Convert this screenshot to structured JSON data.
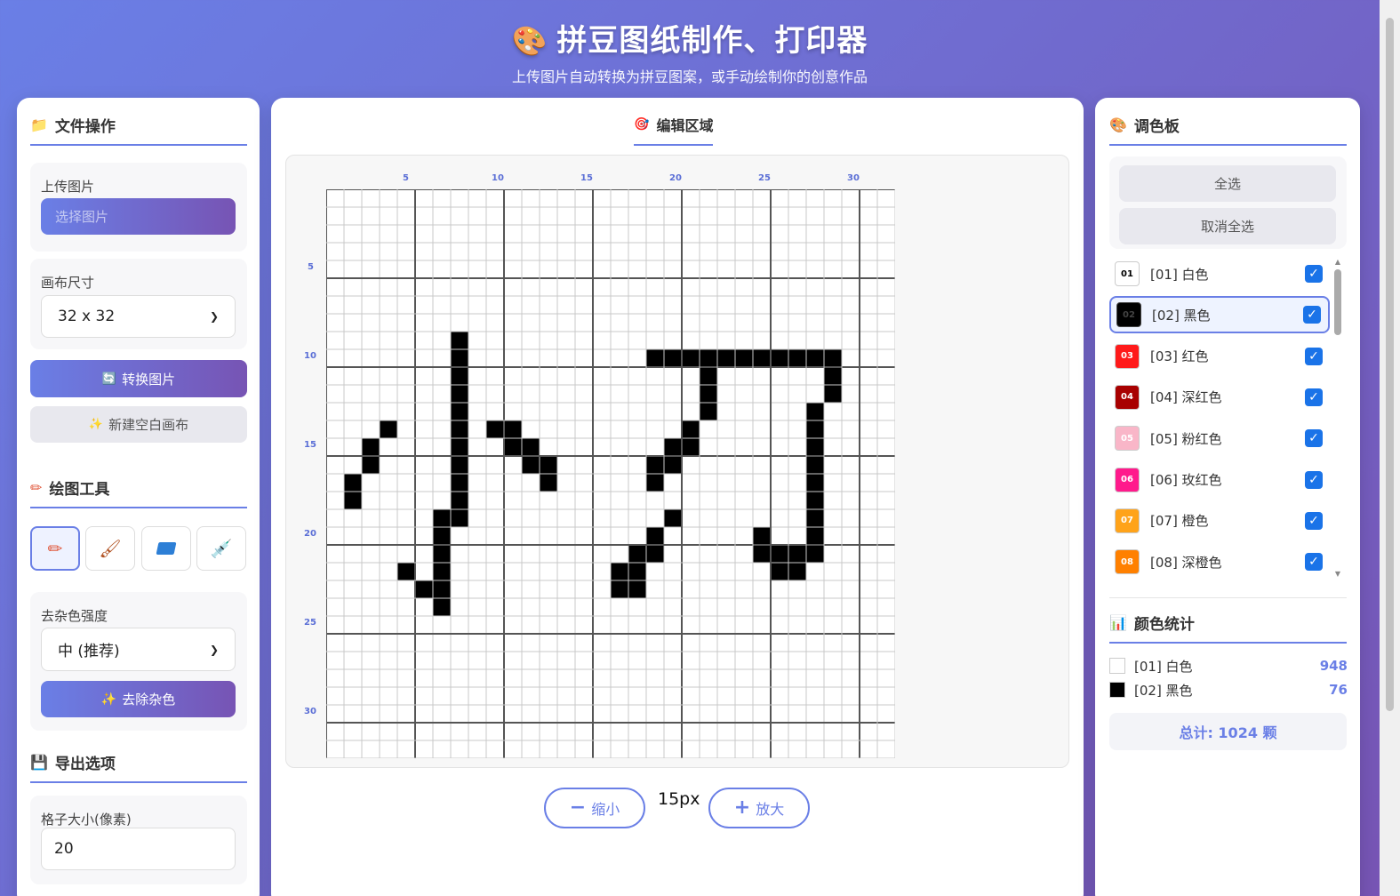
{
  "header": {
    "icon": "palette-icon",
    "title": "拼豆图纸制作、打印器",
    "subtitle": "上传图片自动转换为拼豆图案，或手动绘制你的创意作品"
  },
  "left": {
    "file_ops": {
      "title": "文件操作",
      "icon": "folder-icon"
    },
    "upload_label": "上传图片",
    "upload_button": "选择图片",
    "canvas_size_label": "画布尺寸",
    "canvas_size_value": "32 x 32",
    "convert_button": "转换图片",
    "new_canvas_button": "新建空白画布",
    "drawing_tools": {
      "title": "绘图工具",
      "icon": "pencil-icon"
    },
    "tools": [
      {
        "name": "pencil",
        "icon": "pencil-icon",
        "active": true
      },
      {
        "name": "brush",
        "icon": "paintbrush-icon",
        "active": false
      },
      {
        "name": "eraser",
        "icon": "eraser-icon",
        "active": false
      },
      {
        "name": "eyedropper",
        "icon": "eyedropper-icon",
        "active": false
      }
    ],
    "denoise_label": "去杂色强度",
    "denoise_value": "中 (推荐)",
    "denoise_button": "去除杂色",
    "export": {
      "title": "导出选项",
      "icon": "floppy-icon"
    },
    "cell_size_label": "格子大小(像素)",
    "cell_size_value": "20"
  },
  "center": {
    "title": "编辑区域",
    "icon": "target-icon",
    "grid_cols": 32,
    "grid_rows": 32,
    "axis_labels": [
      "5",
      "10",
      "15",
      "20",
      "25",
      "30"
    ],
    "black_cells": [
      [
        8,
        9
      ],
      [
        8,
        10
      ],
      [
        8,
        11
      ],
      [
        8,
        12
      ],
      [
        8,
        13
      ],
      [
        8,
        14
      ],
      [
        8,
        15
      ],
      [
        8,
        16
      ],
      [
        8,
        17
      ],
      [
        8,
        18
      ],
      [
        8,
        19
      ],
      [
        7,
        19
      ],
      [
        7,
        20
      ],
      [
        7,
        21
      ],
      [
        7,
        22
      ],
      [
        7,
        23
      ],
      [
        7,
        24
      ],
      [
        6,
        23
      ],
      [
        5,
        22
      ],
      [
        4,
        14
      ],
      [
        3,
        15
      ],
      [
        3,
        16
      ],
      [
        2,
        17
      ],
      [
        2,
        18
      ],
      [
        10,
        14
      ],
      [
        11,
        14
      ],
      [
        11,
        15
      ],
      [
        12,
        15
      ],
      [
        12,
        16
      ],
      [
        13,
        16
      ],
      [
        13,
        17
      ],
      [
        19,
        10
      ],
      [
        20,
        10
      ],
      [
        21,
        10
      ],
      [
        22,
        10
      ],
      [
        23,
        10
      ],
      [
        24,
        10
      ],
      [
        25,
        10
      ],
      [
        26,
        10
      ],
      [
        27,
        10
      ],
      [
        28,
        10
      ],
      [
        29,
        10
      ],
      [
        22,
        11
      ],
      [
        22,
        12
      ],
      [
        22,
        13
      ],
      [
        29,
        11
      ],
      [
        29,
        12
      ],
      [
        21,
        14
      ],
      [
        21,
        15
      ],
      [
        20,
        15
      ],
      [
        20,
        16
      ],
      [
        19,
        16
      ],
      [
        19,
        17
      ],
      [
        20,
        19
      ],
      [
        19,
        20
      ],
      [
        19,
        21
      ],
      [
        18,
        21
      ],
      [
        18,
        22
      ],
      [
        17,
        22
      ],
      [
        17,
        23
      ],
      [
        18,
        23
      ],
      [
        28,
        13
      ],
      [
        28,
        14
      ],
      [
        28,
        15
      ],
      [
        28,
        16
      ],
      [
        28,
        17
      ],
      [
        28,
        18
      ],
      [
        28,
        19
      ],
      [
        28,
        20
      ],
      [
        28,
        21
      ],
      [
        25,
        20
      ],
      [
        25,
        21
      ],
      [
        26,
        21
      ],
      [
        27,
        21
      ],
      [
        26,
        22
      ],
      [
        27,
        22
      ]
    ],
    "zoom_out": "缩小",
    "zoom_in": "放大",
    "zoom_level": "15px"
  },
  "right": {
    "palette": {
      "title": "调色板",
      "icon": "palette-icon"
    },
    "select_all": "全选",
    "deselect_all": "取消全选",
    "colors": [
      {
        "code": "01",
        "label": "[01] 白色",
        "hex": "#ffffff",
        "text": "#000000",
        "selected": false
      },
      {
        "code": "02",
        "label": "[02] 黑色",
        "hex": "#000000",
        "text": "#444444",
        "selected": true
      },
      {
        "code": "03",
        "label": "[03] 红色",
        "hex": "#ff1a1a",
        "text": "#ffffff",
        "selected": false
      },
      {
        "code": "04",
        "label": "[04] 深红色",
        "hex": "#a80000",
        "text": "#ffffff",
        "selected": false
      },
      {
        "code": "05",
        "label": "[05] 粉红色",
        "hex": "#f9b6c8",
        "text": "#ffffff",
        "selected": false
      },
      {
        "code": "06",
        "label": "[06] 玫红色",
        "hex": "#ff1a8c",
        "text": "#ffffff",
        "selected": false
      },
      {
        "code": "07",
        "label": "[07] 橙色",
        "hex": "#ffa31a",
        "text": "#ffffff",
        "selected": false
      },
      {
        "code": "08",
        "label": "[08] 深橙色",
        "hex": "#ff8000",
        "text": "#ffffff",
        "selected": false
      }
    ],
    "stats": {
      "title": "颜色统计",
      "icon": "bar-chart-icon"
    },
    "stat_rows": [
      {
        "label": "[01] 白色",
        "count": "948",
        "hex": "#ffffff"
      },
      {
        "label": "[02] 黑色",
        "count": "76",
        "hex": "#000000"
      }
    ],
    "total": "总计: 1024 颗"
  }
}
